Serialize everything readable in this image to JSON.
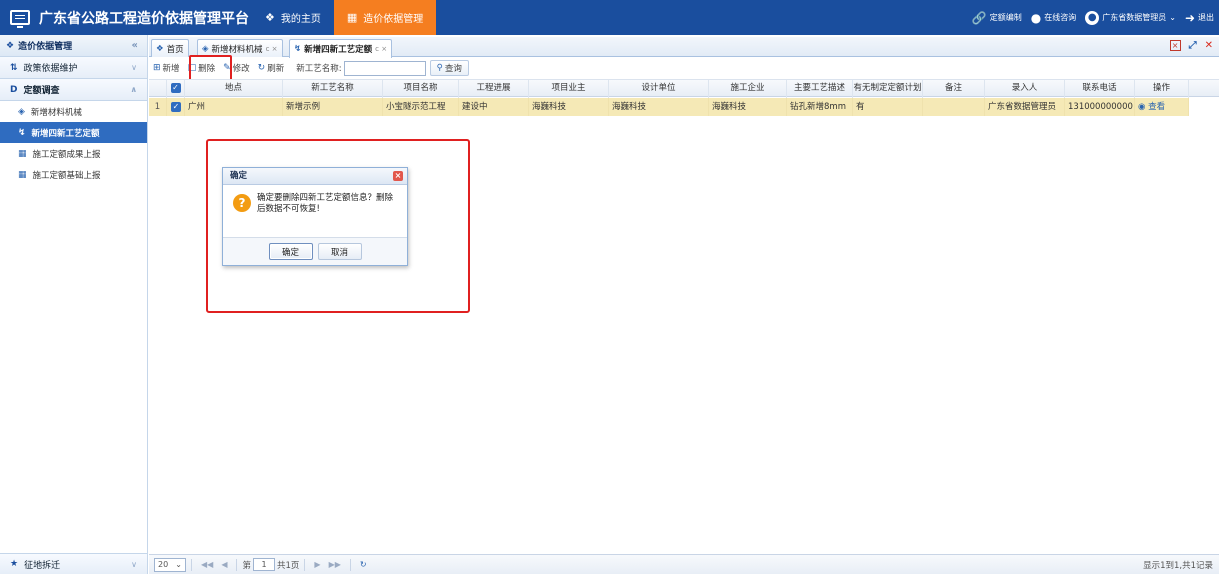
{
  "app": {
    "title": "广东省公路工程造价依据管理平台",
    "nav": [
      {
        "label": "我的主页",
        "icon": "home-icon"
      },
      {
        "label": "造价依据管理",
        "icon": "grid-icon",
        "active": true
      }
    ],
    "right": {
      "quota": "定额编制",
      "consult": "在线咨询",
      "user": "广东省数据管理员",
      "logout": "退出"
    }
  },
  "sidebar": {
    "header": "造价依据管理",
    "groups": [
      {
        "label": "政策依据维护"
      },
      {
        "label": "定额调查"
      }
    ],
    "items": [
      {
        "label": "新增材料机械"
      },
      {
        "label": "新增四新工艺定额",
        "active": true
      },
      {
        "label": "施工定额成果上报"
      },
      {
        "label": "施工定额基础上报"
      }
    ],
    "footer": "征地拆迁"
  },
  "tabs": [
    {
      "label": "首页"
    },
    {
      "label": "新增材料机械",
      "close": "c ×"
    },
    {
      "label": "新增四新工艺定额",
      "close": "c ×",
      "active": true
    }
  ],
  "toolbar": {
    "add": "新增",
    "delete": "删除",
    "edit": "修改",
    "refresh": "刷新",
    "name_label": "新工艺名称:",
    "name_value": "",
    "search": "查询"
  },
  "grid": {
    "columns": [
      "地点",
      "新工艺名称",
      "项目名称",
      "工程进展",
      "项目业主",
      "设计单位",
      "施工企业",
      "主要工艺描述",
      "有无制定定额计划",
      "备注",
      "录入人",
      "联系电话",
      "操作"
    ],
    "rows": [
      {
        "num": "1",
        "location": "广州",
        "process_name": "新增示例",
        "project_name": "小宝隧示范工程",
        "progress": "建设中",
        "owner": "海巍科技",
        "design": "海巍科技",
        "builder": "海巍科技",
        "description": "钻孔新增8mm",
        "has_plan": "有",
        "remark": "",
        "entered_by": "广东省数据管理员",
        "phone": "131000000000",
        "action": "查看"
      }
    ]
  },
  "dialog": {
    "title": "确定",
    "message_line1": "确定要删除四新工艺定额信息？删除",
    "message_line2": "后数据不可恢复!",
    "ok": "确定",
    "cancel": "取消"
  },
  "pager": {
    "page_size": "20",
    "page_label": "第",
    "page_value": "1",
    "page_total": "共1页",
    "info": "显示1到1,共1记录"
  }
}
